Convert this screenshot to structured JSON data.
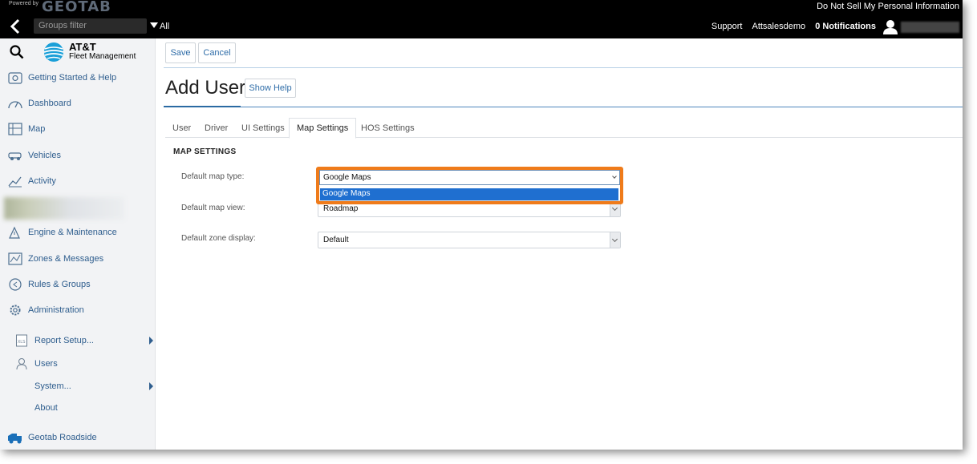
{
  "topbar": {
    "powered_by": "Powered by",
    "logo": "GEOTAB",
    "do_not_sell": "Do Not Sell My Personal Information",
    "groups_placeholder": "Groups filter",
    "groups_scope": "All",
    "support": "Support",
    "account": "Attsalesdemo",
    "notifications": "0 Notifications"
  },
  "brand": {
    "line1": "AT&T",
    "line2": "Fleet Management"
  },
  "sidebar": {
    "items": [
      {
        "label": "Getting Started & Help",
        "icon": "help-icon"
      },
      {
        "label": "Dashboard",
        "icon": "dashboard-icon"
      },
      {
        "label": "Map",
        "icon": "map-icon"
      },
      {
        "label": "Vehicles",
        "icon": "vehicle-icon"
      },
      {
        "label": "Activity",
        "icon": "activity-icon"
      },
      {
        "label": "Engine & Maintenance",
        "icon": "engine-icon"
      },
      {
        "label": "Zones & Messages",
        "icon": "zones-icon"
      },
      {
        "label": "Rules & Groups",
        "icon": "rules-icon"
      },
      {
        "label": "Administration",
        "icon": "gear-icon"
      }
    ],
    "subitems": [
      {
        "label": "Report Setup...",
        "icon": "xls-icon"
      },
      {
        "label": "Users",
        "icon": "user-icon"
      },
      {
        "label": "System..."
      },
      {
        "label": "About"
      }
    ],
    "roadside": "Geotab Roadside"
  },
  "toolbar": {
    "save": "Save",
    "cancel": "Cancel"
  },
  "page": {
    "title": "Add User",
    "show_help": "Show Help"
  },
  "tabs": [
    "User",
    "Driver",
    "UI Settings",
    "Map Settings",
    "HOS Settings"
  ],
  "active_tab": "Map Settings",
  "map_settings": {
    "section_title": "MAP SETTINGS",
    "map_type_label": "Default map type:",
    "map_type_value": "Google Maps",
    "map_type_option": "Google Maps",
    "map_view_label": "Default map view:",
    "map_view_value": "Roadmap",
    "zone_display_label": "Default zone display:",
    "zone_display_value": "Default"
  },
  "colors": {
    "accent": "#2f6da8",
    "highlight": "#ef7b1a",
    "selected_option": "#1f6fd0"
  }
}
